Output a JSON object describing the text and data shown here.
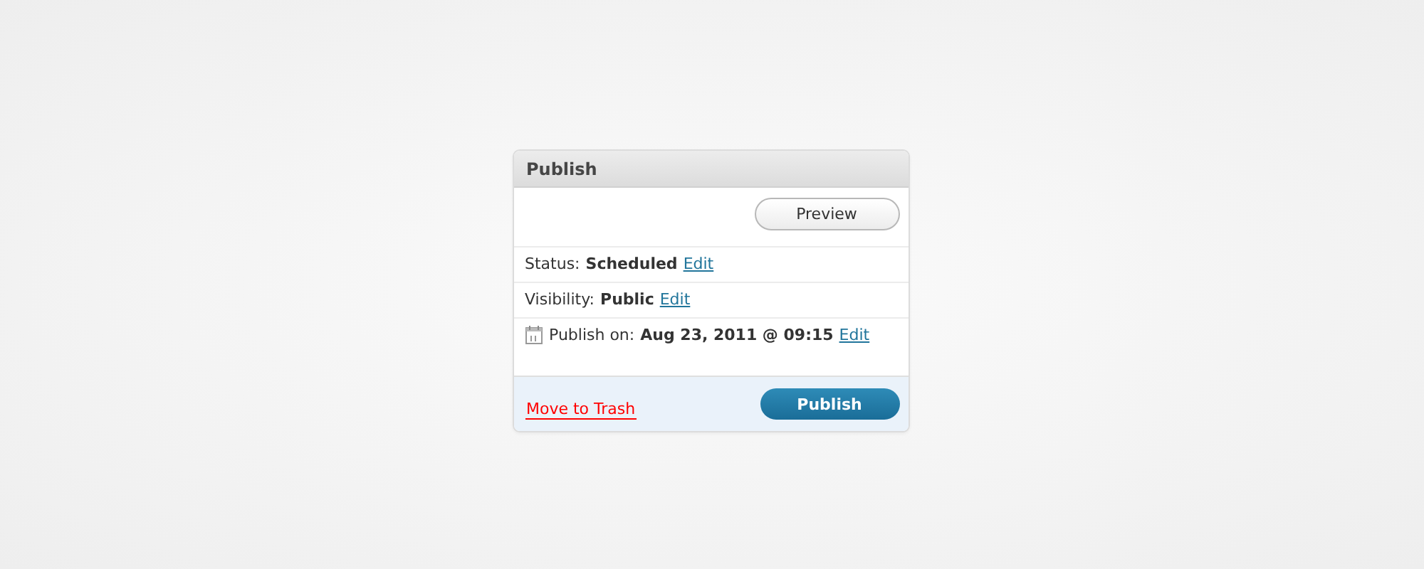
{
  "panel": {
    "title": "Publish",
    "preview_button": "Preview",
    "rows": [
      {
        "kind": "status",
        "label": "Status:",
        "value": "Scheduled",
        "link": "Edit"
      },
      {
        "kind": "visibility",
        "label": "Visibility:",
        "value": "Public",
        "link": "Edit"
      },
      {
        "kind": "schedule",
        "label": "Publish on:",
        "value": "Aug 23, 2011 @ 09:15",
        "link": "Edit"
      }
    ],
    "trash_link": "Move to Trash",
    "publish_button": "Publish"
  }
}
